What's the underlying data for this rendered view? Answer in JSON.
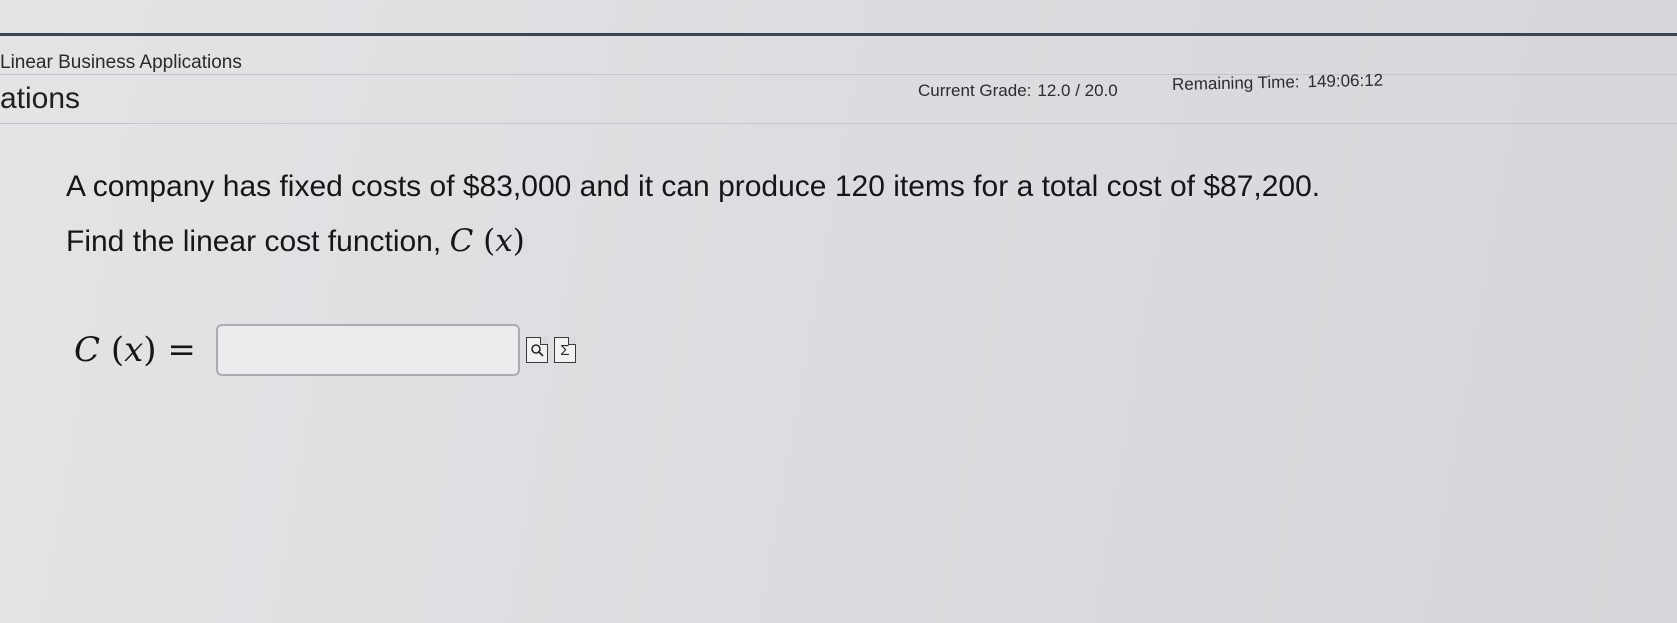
{
  "header": {
    "breadcrumb": "Linear Business Applications",
    "section_title": "ations",
    "grade_label": "Current Grade:",
    "grade_value": "12.0 / 20.0",
    "time_label": "Remaining Time:",
    "time_value": "149:06:12"
  },
  "question": {
    "line1": "A company has fixed costs of $83,000 and it can produce 120 items for a total cost of $87,200.",
    "line2_text": "Find the linear cost function,",
    "line2_func": "C",
    "line2_var": "x"
  },
  "answer": {
    "label_func": "C",
    "label_var": "x",
    "value": "",
    "placeholder": ""
  },
  "tools": [
    {
      "name": "preview-icon"
    },
    {
      "name": "sigma-icon",
      "glyph": "Σ"
    }
  ]
}
